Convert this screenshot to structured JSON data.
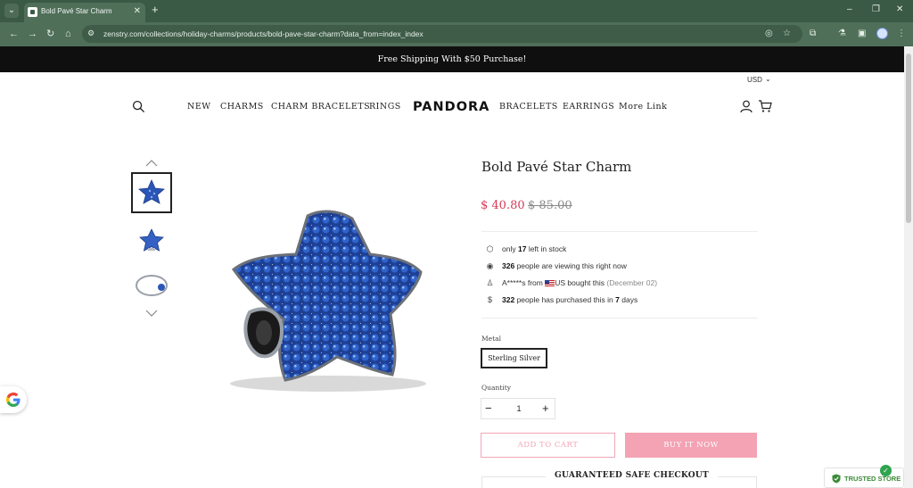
{
  "browser": {
    "tab_title": "Bold Pavé Star Charm",
    "tab_close": "✕",
    "new_tab": "+",
    "url": "zenstry.com/collections/holiday-charms/products/bold-pave-star-charm?data_from=index_index",
    "icons": [
      "tab-list-icon",
      "back-icon",
      "forward-icon",
      "reload-icon",
      "home-icon",
      "site-info-icon",
      "eye-off-icon",
      "bookmark-star-icon",
      "extensions-icon",
      "labs-icon",
      "sidepanel-icon",
      "profile-icon",
      "menu-icon",
      "minimize-icon",
      "restore-icon",
      "close-icon"
    ]
  },
  "announcement": "Free Shipping With $50 Purchase!",
  "currency": {
    "value": "USD"
  },
  "nav": {
    "left": [
      "NEW",
      "CHARMS",
      "CHARM BRACELETS",
      "RINGS"
    ],
    "logo": "PANDORA",
    "right": [
      "BRACELETS",
      "EARRINGS",
      "More Link"
    ]
  },
  "product": {
    "title": "Bold Pavé Star Charm",
    "price": "$ 40.80",
    "compare_price": "$ 85.00",
    "stock": {
      "prefix": "only",
      "count": "17",
      "suffix": "left in stock"
    },
    "viewers": {
      "count": "326",
      "suffix": "people are viewing this right now"
    },
    "recent_buyer": {
      "name": "A*****s",
      "from": "from",
      "country": "US",
      "action": "bought this",
      "date": "(December 02)"
    },
    "purchased": {
      "count": "322",
      "middle": "people has purchased this in",
      "days": "7",
      "suffix": "days"
    },
    "metal_label": "Metal",
    "metal_value": "Sterling Silver",
    "quantity_label": "Quantity",
    "quantity": "1",
    "add_to_cart": "ADD TO CART",
    "buy_now": "BUY IT NOW",
    "checkout_title": "GUARANTEED SAFE CHECKOUT"
  },
  "trusted_badge": "TRUSTED STORE",
  "colors": {
    "announcement_bg": "#0f0f0f",
    "price": "#d33b57",
    "buy_button": "#f3a3b3",
    "charm_blue": "#2b56b8",
    "trusted_green": "#3a8a36"
  }
}
